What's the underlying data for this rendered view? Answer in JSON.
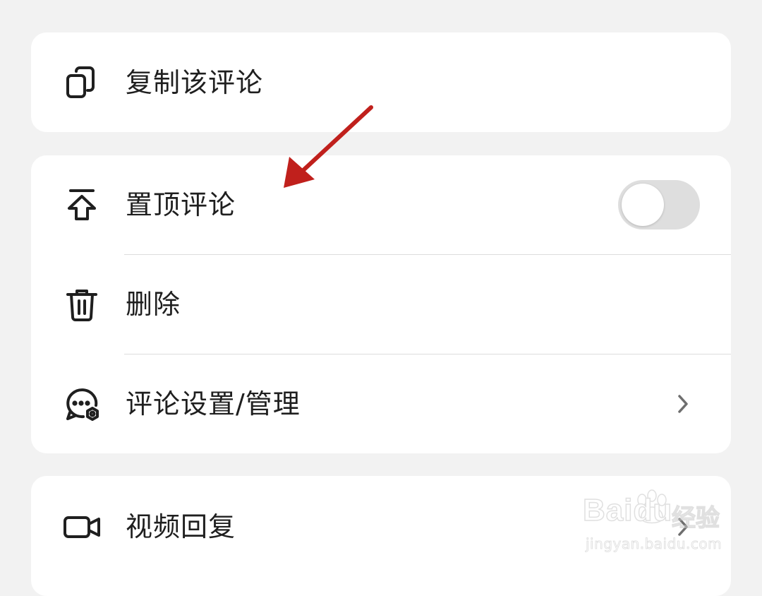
{
  "menu": {
    "copy_comment": {
      "label": "复制该评论",
      "icon": "copy-icon"
    },
    "pin_comment": {
      "label": "置顶评论",
      "icon": "pin-top-icon",
      "toggle_on": false
    },
    "delete": {
      "label": "删除",
      "icon": "trash-icon"
    },
    "comment_settings": {
      "label": "评论设置/管理",
      "icon": "comment-settings-icon"
    },
    "video_reply": {
      "label": "视频回复",
      "icon": "video-camera-icon"
    }
  },
  "watermark": {
    "brand": "Baidu",
    "cn": "经验",
    "url": "jingyan.baidu.com"
  },
  "colors": {
    "background": "#f2f2f2",
    "card": "#ffffff",
    "text": "#1f1f1f",
    "toggle_off": "#dedede",
    "annotation_arrow": "#c0201c"
  }
}
